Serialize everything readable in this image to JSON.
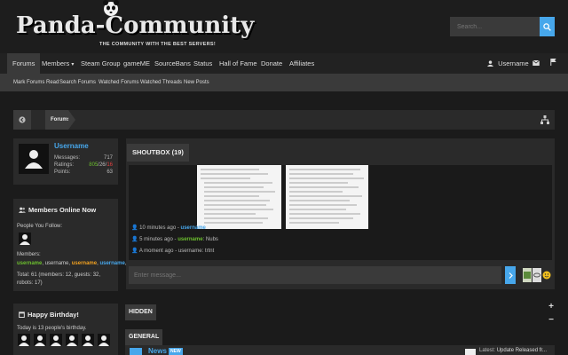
{
  "header": {
    "logo_text": "Panda-Community",
    "tagline": "THE COMMUNITY WITH THE BEST SERVERS!",
    "search_placeholder": "Search..."
  },
  "nav": {
    "items": [
      "Forums",
      "Members",
      "Steam Group",
      "gameME",
      "SourceBans",
      "Status",
      "Hall of Fame",
      "Donate",
      "Affiliates"
    ],
    "username": "Username"
  },
  "subnav": {
    "items": [
      "Mark Forums Read",
      "Search Forums",
      "Watched Forums",
      "Watched Threads",
      "New Posts"
    ]
  },
  "breadcrumb": {
    "current": "Forums"
  },
  "user_panel": {
    "username": "Username",
    "messages_label": "Messages:",
    "messages_value": "717",
    "ratings_label": "Ratings:",
    "ratings_pos": "805",
    "ratings_neu": "26",
    "ratings_neg": "16",
    "points_label": "Points:",
    "points_value": "63"
  },
  "members_online": {
    "title": "Members Online Now",
    "follow_label": "People You Follow:",
    "members_label": "Members:",
    "members": [
      "username",
      "username",
      "username",
      "username"
    ],
    "total": "Total: 61 (members: 12, guests: 32, robots: 17)"
  },
  "birthday": {
    "title": "Happy Birthday!",
    "text": "Today is 13 people's birthday."
  },
  "shoutbox": {
    "title": "SHOUTBOX (19)",
    "shouts": [
      {
        "time": "10 minutes ago",
        "user": "username",
        "text": ""
      },
      {
        "time": "5 minutes ago",
        "user": "username",
        "text": "Nubs"
      },
      {
        "time": "A moment ago",
        "user": "username",
        "text": "trtnt"
      }
    ],
    "input_placeholder": "Enter message..."
  },
  "categories": {
    "hidden": "HIDDEN",
    "general": "GENERAL",
    "news_label": "News",
    "news_badge": "NEW",
    "latest_label": "Latest:",
    "latest_text": "Update Released fr..."
  },
  "colors": {
    "accent": "#47a7eb",
    "green": "#6cbf2e",
    "red": "#e04040"
  }
}
